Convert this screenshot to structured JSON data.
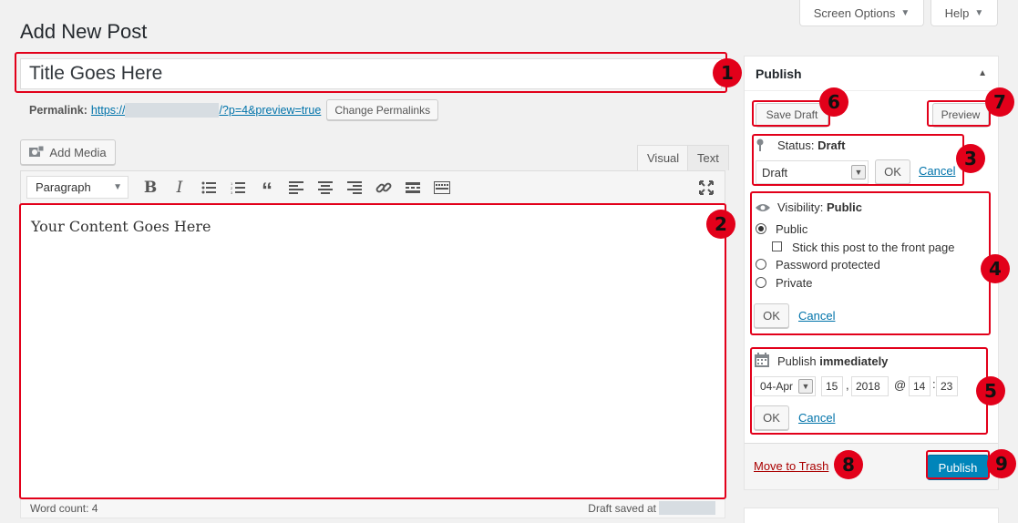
{
  "header": {
    "screen_options": "Screen Options",
    "help": "Help",
    "page_title": "Add New Post"
  },
  "post": {
    "title": "Title Goes Here",
    "permalink_label": "Permalink:",
    "permalink_prefix": "https://",
    "permalink_suffix": "/?p=4&preview=true",
    "change_permalinks": "Change Permalinks",
    "content": "Your Content Goes Here"
  },
  "editor": {
    "add_media": "Add Media",
    "tab_visual": "Visual",
    "tab_text": "Text",
    "format_select": "Paragraph",
    "word_count": "Word count: 4",
    "draft_saved": "Draft saved at"
  },
  "publish": {
    "heading": "Publish",
    "save_draft": "Save Draft",
    "preview": "Preview",
    "status_label": "Status:",
    "status_value": "Draft",
    "status_select": "Draft",
    "ok": "OK",
    "cancel": "Cancel",
    "visibility_label": "Visibility:",
    "visibility_value": "Public",
    "opt_public": "Public",
    "opt_sticky": "Stick this post to the front page",
    "opt_password": "Password protected",
    "opt_private": "Private",
    "publish_label": "Publish",
    "publish_value": "immediately",
    "month": "04-Apr",
    "day": "15",
    "year": "2018",
    "hour": "14",
    "minute": "23",
    "comma": ",",
    "at": "@",
    "colon": ":",
    "move_to_trash": "Move to Trash",
    "publish_button": "Publish"
  },
  "annotations": [
    "1",
    "2",
    "3",
    "4",
    "5",
    "6",
    "7",
    "8",
    "9"
  ],
  "colors": {
    "annotation_red": "#e2001a",
    "primary_blue": "#0085ba",
    "link_blue": "#0073aa"
  }
}
